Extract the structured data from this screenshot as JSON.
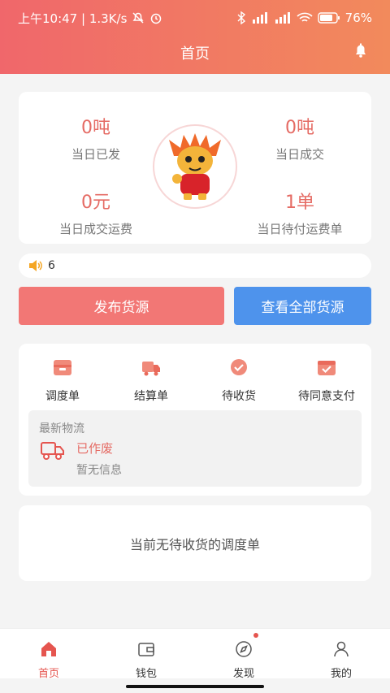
{
  "status_bar": {
    "time": "上午10:47 | 1.3K/s",
    "battery": "76%"
  },
  "header": {
    "title": "首页"
  },
  "stats": {
    "shipped_value": "0吨",
    "shipped_label": "当日已发",
    "deal_value": "0吨",
    "deal_label": "当日成交",
    "freight_value": "0元",
    "freight_label": "当日成交运费",
    "pending_value": "1单",
    "pending_label": "当日待付运费单"
  },
  "notice": {
    "count": "6"
  },
  "actions": {
    "publish": "发布货源",
    "view_all": "查看全部货源"
  },
  "menu": [
    {
      "label": "调度单",
      "icon": "dispatch-icon"
    },
    {
      "label": "结算单",
      "icon": "truck-icon"
    },
    {
      "label": "待收货",
      "icon": "check-circle-icon"
    },
    {
      "label": "待同意支付",
      "icon": "check-box-icon"
    }
  ],
  "logistics": {
    "header": "最新物流",
    "status": "已作废",
    "info": "暂无信息"
  },
  "empty_message": "当前无待收货的调度单",
  "tabs": [
    {
      "label": "首页",
      "icon": "home-icon"
    },
    {
      "label": "钱包",
      "icon": "wallet-icon"
    },
    {
      "label": "发现",
      "icon": "compass-icon"
    },
    {
      "label": "我的",
      "icon": "user-icon"
    }
  ],
  "colors": {
    "accent": "#e5554f",
    "publish": "#f27775",
    "view_all": "#4e93ec"
  }
}
